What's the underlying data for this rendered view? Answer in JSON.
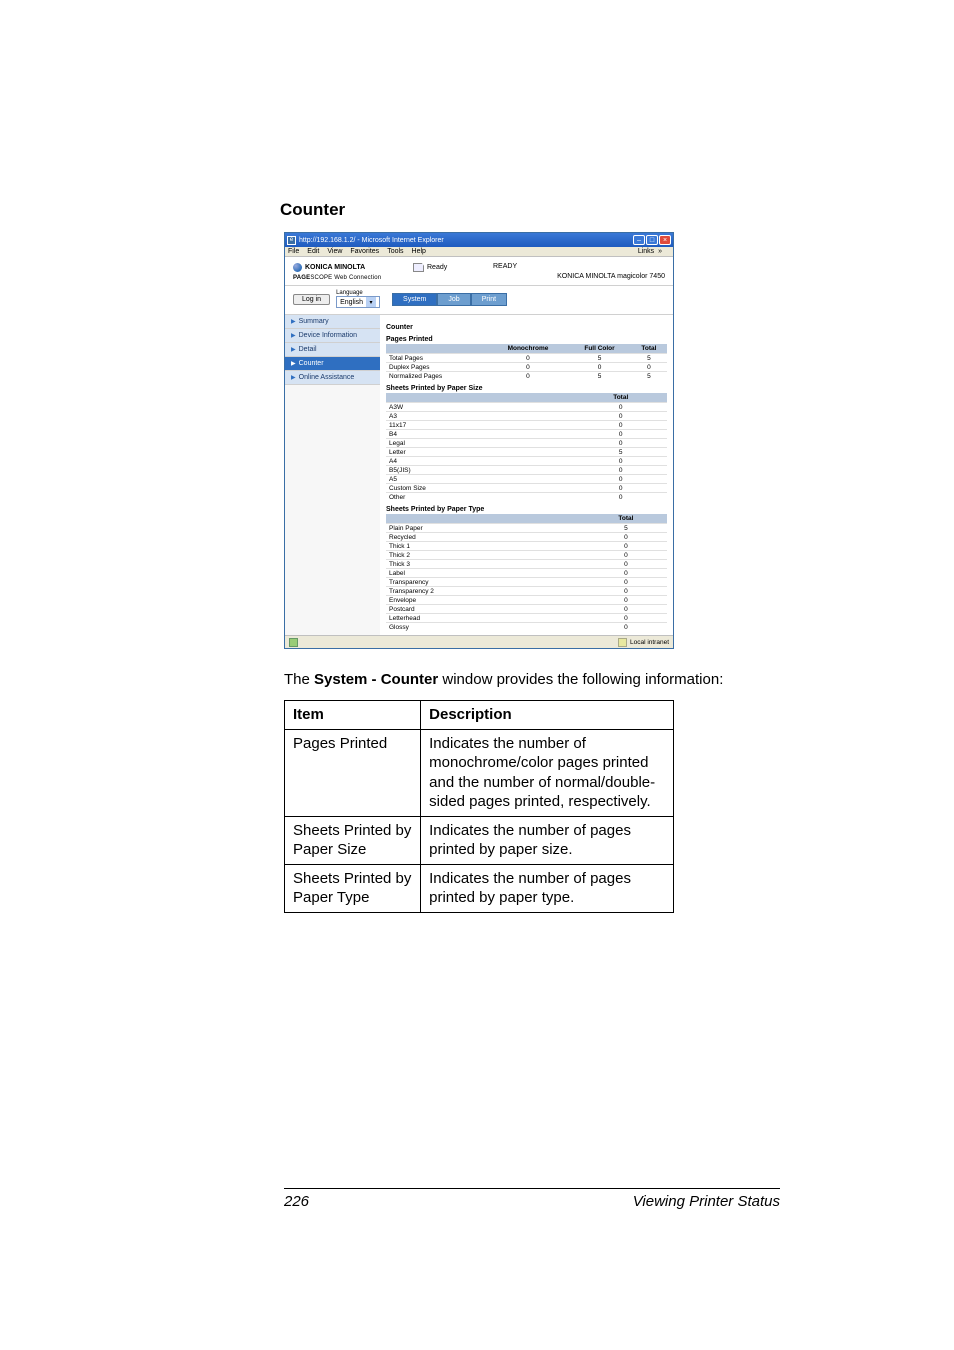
{
  "section_title": "Counter",
  "browser": {
    "title": "http://192.168.1.2/ - Microsoft Internet Explorer",
    "menu": [
      "File",
      "Edit",
      "View",
      "Favorites",
      "Tools",
      "Help"
    ],
    "links_label": "Links",
    "status_left_icon": "done-icon",
    "status_zone": "Local intranet"
  },
  "header": {
    "brand": "KONICA MINOLTA",
    "product_line1": "PAGE",
    "product_line2": "SCOPE",
    "product_tail": "Web Connection",
    "ready_label": "Ready",
    "status_text": "READY",
    "model": "KONICA MINOLTA magicolor 7450"
  },
  "controls": {
    "login": "Log in",
    "language_label": "Language",
    "language_value": "English",
    "tabs": [
      "System",
      "Job",
      "Print"
    ]
  },
  "sidenav": [
    "Summary",
    "Device Information",
    "Detail",
    "Counter",
    "Online Assistance"
  ],
  "content": {
    "title": "Counter",
    "pages_printed": {
      "label": "Pages Printed",
      "headers": [
        "",
        "Monochrome",
        "Full Color",
        "Total"
      ],
      "rows": [
        {
          "label": "Total Pages",
          "mono": "0",
          "full": "5",
          "total": "5"
        },
        {
          "label": "Duplex Pages",
          "mono": "0",
          "full": "0",
          "total": "0"
        },
        {
          "label": "Normalized Pages",
          "mono": "0",
          "full": "5",
          "total": "5"
        }
      ]
    },
    "by_size": {
      "label": "Sheets Printed by Paper Size",
      "header": "Total",
      "rows": [
        {
          "label": "A3W",
          "val": "0"
        },
        {
          "label": "A3",
          "val": "0"
        },
        {
          "label": "11x17",
          "val": "0"
        },
        {
          "label": "B4",
          "val": "0"
        },
        {
          "label": "Legal",
          "val": "0"
        },
        {
          "label": "Letter",
          "val": "5"
        },
        {
          "label": "A4",
          "val": "0"
        },
        {
          "label": "B5(JIS)",
          "val": "0"
        },
        {
          "label": "A5",
          "val": "0"
        },
        {
          "label": "Custom Size",
          "val": "0"
        },
        {
          "label": "Other",
          "val": "0"
        }
      ]
    },
    "by_type": {
      "label": "Sheets Printed by Paper Type",
      "header": "Total",
      "rows": [
        {
          "label": "Plain Paper",
          "val": "5"
        },
        {
          "label": "Recycled",
          "val": "0"
        },
        {
          "label": "Thick 1",
          "val": "0"
        },
        {
          "label": "Thick 2",
          "val": "0"
        },
        {
          "label": "Thick 3",
          "val": "0"
        },
        {
          "label": "Label",
          "val": "0"
        },
        {
          "label": "Transparency",
          "val": "0"
        },
        {
          "label": "Transparency 2",
          "val": "0"
        },
        {
          "label": "Envelope",
          "val": "0"
        },
        {
          "label": "Postcard",
          "val": "0"
        },
        {
          "label": "Letterhead",
          "val": "0"
        },
        {
          "label": "Glossy",
          "val": "0"
        }
      ]
    }
  },
  "caption_prefix": "The ",
  "caption_bold": "System - Counter",
  "caption_suffix": " window provides the following information:",
  "info_table": {
    "headers": [
      "Item",
      "Description"
    ],
    "rows": [
      {
        "item": "Pages Printed",
        "desc": "Indicates the number of monochrome/color pages printed and the number of normal/double-sided pages printed, respectively."
      },
      {
        "item": "Sheets Printed by Paper Size",
        "desc": "Indicates the number of pages printed by paper size."
      },
      {
        "item": "Sheets Printed by Paper Type",
        "desc": "Indicates the number of pages printed by paper type."
      }
    ]
  },
  "footer": {
    "page": "226",
    "section": "Viewing Printer Status"
  }
}
